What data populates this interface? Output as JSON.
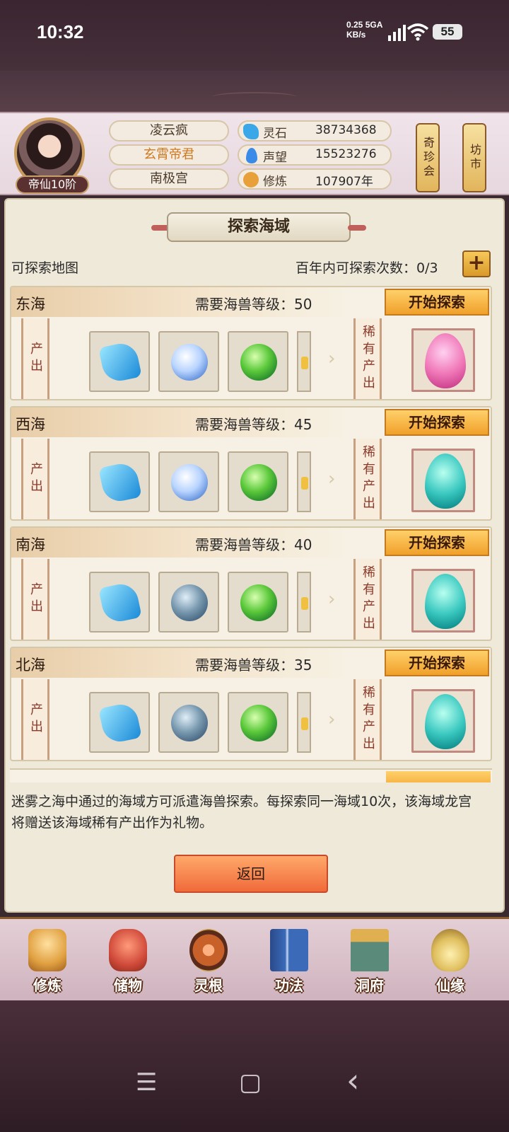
{
  "status_bar": {
    "time": "10:32",
    "net_speed": "0.25",
    "net_unit": "KB/s",
    "net_type": "5GA",
    "battery": "55"
  },
  "player": {
    "rank_badge": "帝仙10阶",
    "name": "凌云疯",
    "title": "玄霄帝君",
    "sect": "南极宫"
  },
  "resources": [
    {
      "label": "灵石",
      "value": "38734368",
      "icon": "spirit-stone-icon",
      "color": "#3aa8e8"
    },
    {
      "label": "声望",
      "value": "15523276",
      "icon": "prestige-icon",
      "color": "#3a8ae8"
    },
    {
      "label": "修炼",
      "value": "107907年",
      "icon": "meditation-icon",
      "color": "#e8a03a"
    }
  ],
  "side_buttons": {
    "treasure_fair": "奇珍会",
    "market": "坊市"
  },
  "panel": {
    "title": "探索海域",
    "map_label": "可探索地图",
    "count_label": "百年内可探索次数：0/3",
    "plus": "+"
  },
  "labels": {
    "output": "产出",
    "rare_output": "稀有产出",
    "start_explore": "开始探索"
  },
  "seas": [
    {
      "name": "东海",
      "requirement": "需要海兽等级：50",
      "items": [
        "ice-crystal",
        "white-orb",
        "green-orb"
      ],
      "rare_egg": "pink-egg"
    },
    {
      "name": "西海",
      "requirement": "需要海兽等级：45",
      "items": [
        "ice-crystal",
        "white-orb",
        "green-orb"
      ],
      "rare_egg": "teal-egg"
    },
    {
      "name": "南海",
      "requirement": "需要海兽等级：40",
      "items": [
        "ice-crystal",
        "dark-orb",
        "green-orb"
      ],
      "rare_egg": "teal-egg"
    },
    {
      "name": "北海",
      "requirement": "需要海兽等级：35",
      "items": [
        "ice-crystal",
        "dark-orb",
        "green-orb"
      ],
      "rare_egg": "teal-egg"
    }
  ],
  "description": "迷雾之海中通过的海域方可派遣海兽探索。每探索同一海域10次，该海域龙宫将赠送该海域稀有产出作为礼物。",
  "back_button": "返回",
  "bottom_nav": [
    {
      "label": "修炼",
      "icon": "cultivation-icon",
      "color": "#e0a040"
    },
    {
      "label": "储物",
      "icon": "storage-bag-icon",
      "color": "#d04a3a"
    },
    {
      "label": "灵根",
      "icon": "spirit-root-icon",
      "color": "#c8602a"
    },
    {
      "label": "功法",
      "icon": "technique-book-icon",
      "color": "#3a6ab8"
    },
    {
      "label": "洞府",
      "icon": "cave-palace-icon",
      "color": "#c89040"
    },
    {
      "label": "仙缘",
      "icon": "immortal-fate-icon",
      "color": "#e0c060"
    }
  ],
  "android_nav": {
    "menu": "☰",
    "home": "▢",
    "back": "‹"
  }
}
